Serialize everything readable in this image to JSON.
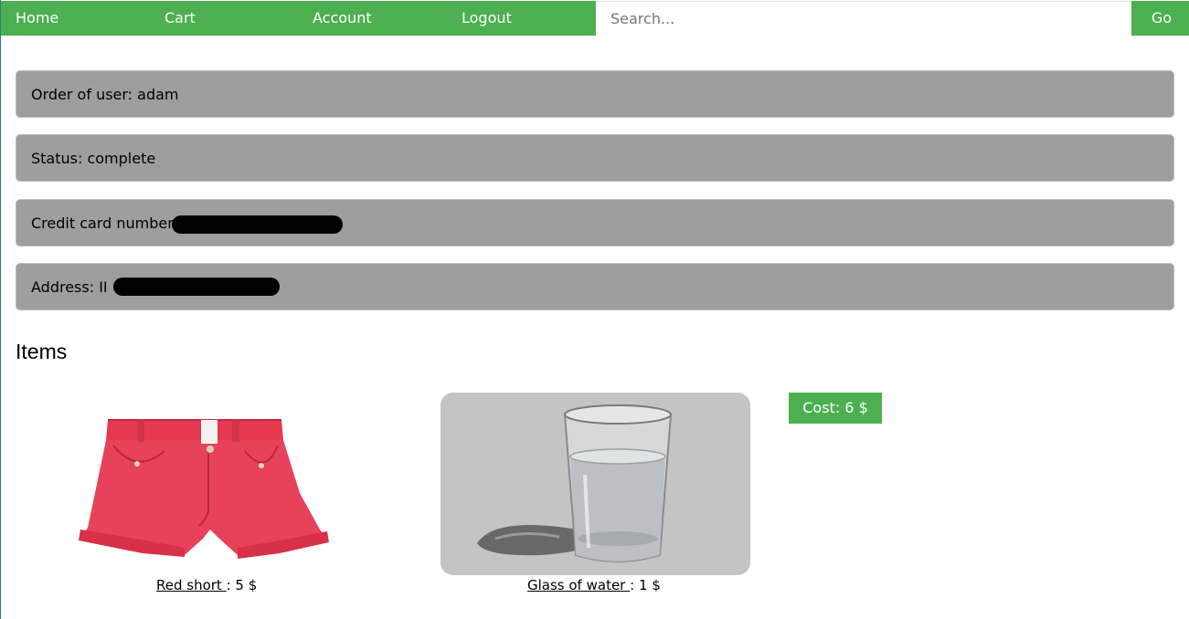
{
  "nav": {
    "home_label": "Home",
    "cart_label": "Cart",
    "account_label": "Account",
    "logout_label": "Logout",
    "search_placeholder": "Search...",
    "search_value": "",
    "go_label": "Go"
  },
  "order": {
    "user_line": "Order of user: adam",
    "status_line": "Status: complete",
    "card_line": "Credit card number:",
    "address_line": "Address: II"
  },
  "items_heading": "Items",
  "items": [
    {
      "name": "Red short ",
      "price_text": ": 5 $"
    },
    {
      "name": "Glass of water ",
      "price_text": ": 1 $"
    }
  ],
  "cost_label": "Cost: 6 $",
  "colors": {
    "accent": "#4caf50",
    "panel": "#9e9e9e",
    "short_red": "#e6394f",
    "image_bg": "#c8c8c8"
  }
}
